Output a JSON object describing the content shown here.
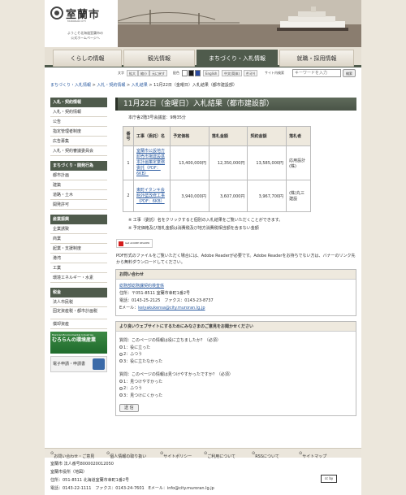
{
  "header": {
    "logo_title": "室蘭市",
    "logo_sub": "MURORAN CITY",
    "logo_caption_1": "ようこそ北海道室蘭市の",
    "logo_caption_2": "公式ホームページへ"
  },
  "nav": {
    "tabs": [
      {
        "label": "くらしの情報",
        "active": false
      },
      {
        "label": "観光情報",
        "active": false
      },
      {
        "label": "まちづくり・入札情報",
        "active": true
      },
      {
        "label": "就職・採用情報",
        "active": false
      }
    ]
  },
  "tools": {
    "text_label": "文字",
    "sizes": [
      "拡大",
      "縮小",
      "元に戻す"
    ],
    "color_label": "配色",
    "colors": [
      {
        "label": "白",
        "hex": "#ffffff"
      },
      {
        "label": "黒",
        "hex": "#1a1a1a"
      },
      {
        "label": "青",
        "hex": "#2a4aa0"
      }
    ],
    "languages": [
      "English",
      "中文(简体)",
      "한국어"
    ],
    "search_label": "サイト内検索",
    "search_placeholder": "キーワードを入力",
    "search_button": "検索"
  },
  "breadcrumb": {
    "items": [
      "まちづくり・入札情報",
      "入札・契約情報",
      "入札結果",
      "11月22日（金曜日）入札結果（都市建設部）"
    ],
    "separator": " > "
  },
  "sidebar": {
    "sections": [
      {
        "title": "入札・契約情報",
        "items": [
          "入札・契約情報",
          "公告",
          "指定管理者制度",
          "広告募集",
          "入札・契約審議委員会"
        ]
      },
      {
        "title": "まちづくり・開発行為",
        "items": [
          "都市計画",
          "建築",
          "道路・土木",
          "開発許可"
        ]
      },
      {
        "title": "産業振興",
        "items": [
          "企業誘致",
          "商業",
          "起業・支援制度",
          "港湾",
          "工業",
          "環境エネルギー・水素"
        ]
      },
      {
        "title": "税金",
        "items": [
          "法人市民税",
          "固定資産税・都市計画税",
          "償却資産"
        ]
      }
    ],
    "banner_env_small": "Muroran Environmental Industries",
    "banner_env_large": "むろらんの環境産業",
    "banner_app": "電子申請・申請書"
  },
  "main": {
    "title": "11月22日（金曜日）入札結果（都市建設部）",
    "meeting": "本庁舎2階3号会議室：9時35分",
    "table": {
      "headers": [
        "番号",
        "工事（委託）名",
        "予定価格",
        "落札金額",
        "契約金額",
        "落札者"
      ],
      "rows": [
        {
          "no": "1",
          "name": "室蘭市公設地方卸売市場建設基本計画策定業務委託（PDF：6KB）",
          "planned": "13,400,000円",
          "bid": "12,350,000円",
          "contract": "13,585,000円",
          "winner": "応用設計(株)"
        },
        {
          "no": "2",
          "name": "東町イタンキ会館外壁改修工事（PDF：6KB）",
          "planned": "3,940,000円",
          "bid": "3,607,000円",
          "contract": "3,967,700円",
          "winner": "(株)丸三建設"
        }
      ]
    },
    "notes": [
      "※ 工事（委託）名をクリックすると個別の入札結果をご覧いただくことができます。",
      "※ 予定価格及び落札金額は消費税及び地方消費税相当額を含まない金額"
    ],
    "pdf_badge": "Get ADOBE READER",
    "pdf_text": "PDF形式のファイルをご覧いただく場合には、Adobe Readerが必要です。Adobe Readerをお持ちでない方は、バナーのリンク先から無料ダウンロードしてください。"
  },
  "contact": {
    "title": "お問い合わせ",
    "dept": "総務部総務課契約検査係",
    "address": "住所：〒051-8511 室蘭市幸町1番2号",
    "phone": "電話：0143-25-2125　ファクス：0143-23-8737",
    "email_label": "Eメール：",
    "email": "keiyakukensa@city.muroran.lg.jp"
  },
  "survey": {
    "title": "より良いウェブサイトにするためにみなさまのご意見をお聞かせください",
    "q1": "質問：このページの情報は役に立ちましたか？（必須）",
    "q1_options": [
      "1：役に立った",
      "2：ふつう",
      "3：役に立たなかった"
    ],
    "q2": "質問：このページの情報は見つけやすかったですか？（必須）",
    "q2_options": [
      "1：見つけやすかった",
      "2：ふつう",
      "3：見つけにくかった"
    ],
    "submit": "送 信"
  },
  "footer": {
    "links": [
      "お問い合わせ・ご意見",
      "個人情報の取り扱い",
      "サイトポリシー",
      "ご利用について",
      "RSSについて",
      "サイトマップ"
    ],
    "corp_no": "室蘭市 法人番号8000020012050",
    "office": "室蘭市役所（地図）",
    "address": "住所：051-8511 北海道室蘭市幸町1番2号",
    "phone": "電話：0143-22-1111　ファクス：0143-24-7601　Eメール：info@city.muroran.lg.jp",
    "cc": "cc by"
  }
}
